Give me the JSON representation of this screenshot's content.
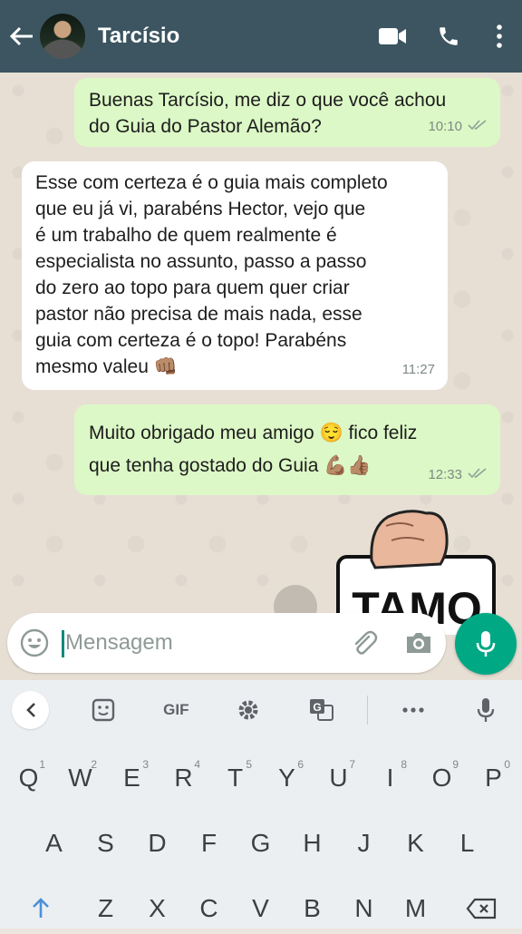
{
  "header": {
    "name": "Tarcísio"
  },
  "messages": [
    {
      "dir": "out",
      "text": "Buenas Tarcísio, me diz o que você achou\ndo Guia do Pastor Alemão?",
      "time": "10:10"
    },
    {
      "dir": "in",
      "text": "Esse com certeza é o guia mais completo\nque eu já vi, parabéns Hector, vejo que\né um trabalho de quem realmente é\nespecialista no assunto, passo a passo\ndo zero ao topo para quem quer criar\npastor não precisa de mais nada, esse\nguia com certeza é o topo! Parabéns\nmesmo valeu 👊🏽",
      "time": "11:27"
    },
    {
      "dir": "out",
      "text": "Muito obrigado meu amigo 😌 fico feliz\nque tenha gostado do Guia 💪🏽👍🏽",
      "time": "12:33"
    }
  ],
  "sticker": {
    "text": "TAMO"
  },
  "input": {
    "placeholder": "Mensagem"
  },
  "keyboard": {
    "toolbar": {
      "gif": "GIF"
    },
    "row1": [
      {
        "k": "Q",
        "n": "1"
      },
      {
        "k": "W",
        "n": "2"
      },
      {
        "k": "E",
        "n": "3"
      },
      {
        "k": "R",
        "n": "4"
      },
      {
        "k": "T",
        "n": "5"
      },
      {
        "k": "Y",
        "n": "6"
      },
      {
        "k": "U",
        "n": "7"
      },
      {
        "k": "I",
        "n": "8"
      },
      {
        "k": "O",
        "n": "9"
      },
      {
        "k": "P",
        "n": "0"
      }
    ],
    "row2": [
      "A",
      "S",
      "D",
      "F",
      "G",
      "H",
      "J",
      "K",
      "L"
    ],
    "row3": [
      "Z",
      "X",
      "C",
      "V",
      "B",
      "N",
      "M"
    ]
  },
  "colors": {
    "header": "#3c5560",
    "outgoing": "#dcf8c6",
    "incoming": "#ffffff",
    "accent": "#01a884",
    "ticks": "#7d8a83"
  }
}
